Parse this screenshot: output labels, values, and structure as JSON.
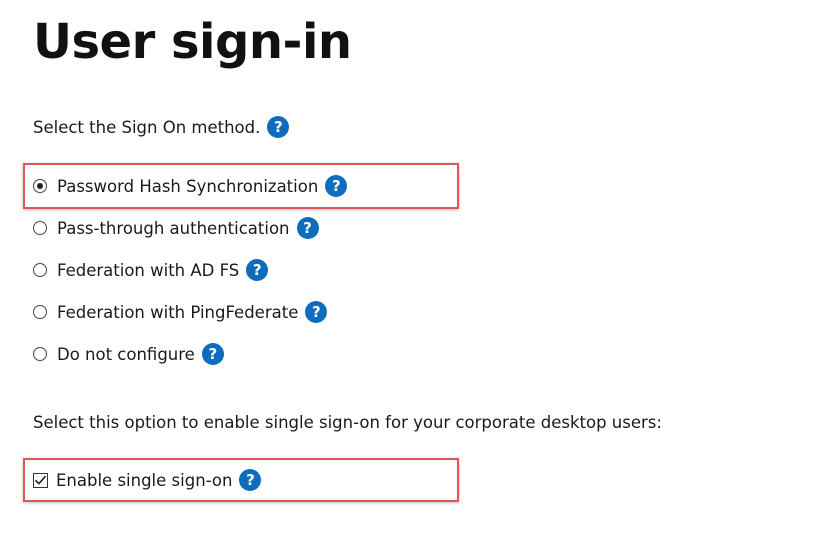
{
  "page": {
    "title": "User sign-in",
    "signon_prompt": "Select the Sign On method.",
    "help_glyph": "?",
    "help_icon_color": "#0f6cbd",
    "highlight_color": "#e05555"
  },
  "signon_methods": [
    {
      "label": "Password Hash Synchronization",
      "selected": true
    },
    {
      "label": "Pass-through authentication",
      "selected": false
    },
    {
      "label": "Federation with AD FS",
      "selected": false
    },
    {
      "label": "Federation with PingFederate",
      "selected": false
    },
    {
      "label": "Do not configure",
      "selected": false
    }
  ],
  "sso": {
    "prompt": "Select this option to enable single sign-on for your corporate desktop users:",
    "checkbox_label": "Enable single sign-on",
    "checked": true
  }
}
